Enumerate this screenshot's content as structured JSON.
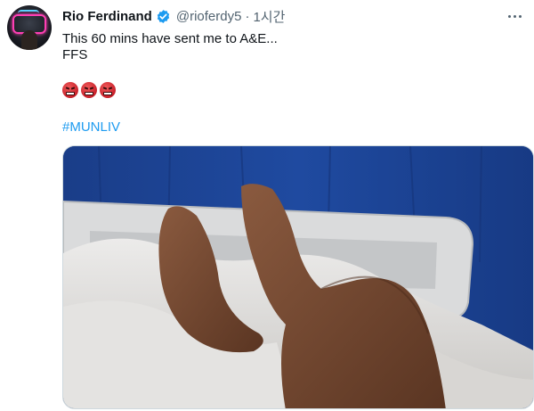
{
  "tweet": {
    "author_name": "Rio Ferdinand",
    "handle": "@rioferdy5",
    "separator": "·",
    "time": "1시간",
    "text_line1": "This 60 mins have sent me to A&E...",
    "text_line2": "FFS",
    "emojis": [
      "angry-face",
      "angry-face",
      "angry-face"
    ],
    "hashtag": "#MUNLIV",
    "verified": true
  },
  "colors": {
    "link": "#1d9bf0",
    "secondary_text": "#536471",
    "verified_badge": "#1d9bf0"
  },
  "icons": {
    "verified": "verified-badge-icon",
    "more": "more-options-icon"
  }
}
